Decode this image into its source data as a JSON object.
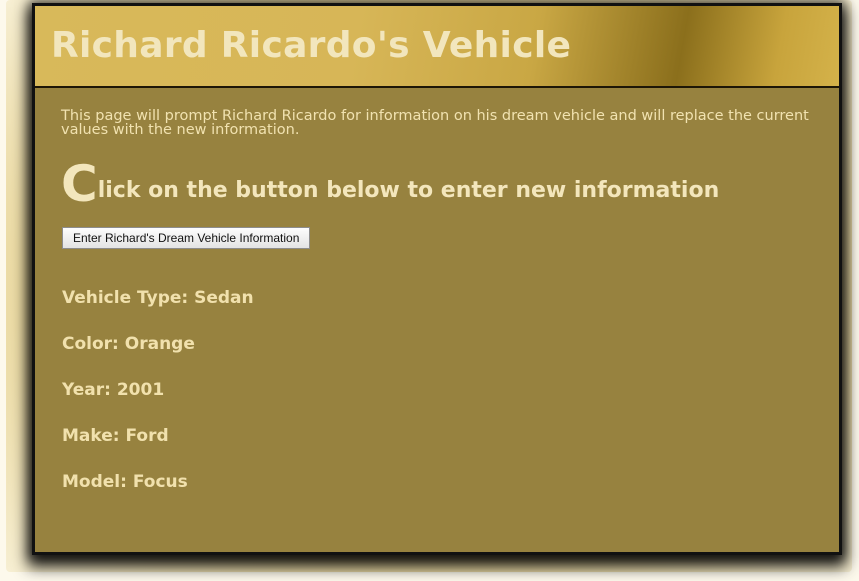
{
  "page": {
    "title": "Richard Ricardo's Vehicle",
    "intro": "This page will prompt Richard Ricardo for information on his dream vehicle and will replace the current values with the new information.",
    "heading_initial": "C",
    "heading_rest": "lick on the button below to enter new information",
    "button_label": "Enter Richard's Dream Vehicle Information"
  },
  "vehicle": {
    "type": "Vehicle Type: Sedan",
    "color": "Color: Orange",
    "year": "Year: 2001",
    "make": "Make: Ford",
    "model": "Model: Focus"
  },
  "colors": {
    "content_background": "#97823f",
    "header_gold": "#d8b95a",
    "text_cream": "#f1e1ad"
  }
}
